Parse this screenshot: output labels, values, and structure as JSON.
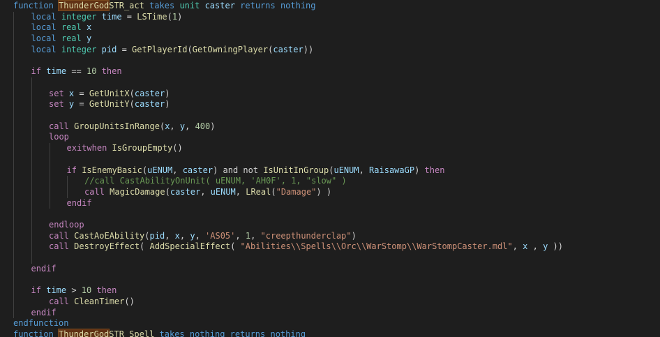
{
  "editor": {
    "theme": {
      "background": "#1e1e1e",
      "keyword": "#569cd6",
      "control": "#c586c0",
      "function": "#dcdcaa",
      "variable": "#9cdcfe",
      "type": "#4ec9b0",
      "string": "#ce9178",
      "number": "#b5cea8",
      "comment": "#6a9955",
      "highlight": "#613214"
    },
    "lines": [
      {
        "indent": 0,
        "tokens": [
          {
            "t": "function",
            "c": "kw"
          },
          {
            "t": " ",
            "c": "plain"
          },
          {
            "t": "ThunderGod",
            "c": "hl"
          },
          {
            "t": "STR_act",
            "c": "fn"
          },
          {
            "t": " takes ",
            "c": "kw"
          },
          {
            "t": "unit",
            "c": "type"
          },
          {
            "t": " caster ",
            "c": "var"
          },
          {
            "t": "returns nothing",
            "c": "kw"
          }
        ]
      },
      {
        "indent": 1,
        "tokens": [
          {
            "t": "local ",
            "c": "kw"
          },
          {
            "t": "integer",
            "c": "type"
          },
          {
            "t": " time",
            "c": "var"
          },
          {
            "t": " = ",
            "c": "op"
          },
          {
            "t": "LSTime",
            "c": "fn"
          },
          {
            "t": "(",
            "c": "op"
          },
          {
            "t": "1",
            "c": "num"
          },
          {
            "t": ")",
            "c": "op"
          }
        ]
      },
      {
        "indent": 1,
        "tokens": [
          {
            "t": "local ",
            "c": "kw"
          },
          {
            "t": "real",
            "c": "type"
          },
          {
            "t": " x",
            "c": "var"
          }
        ]
      },
      {
        "indent": 1,
        "tokens": [
          {
            "t": "local ",
            "c": "kw"
          },
          {
            "t": "real",
            "c": "type"
          },
          {
            "t": " y",
            "c": "var"
          }
        ]
      },
      {
        "indent": 1,
        "tokens": [
          {
            "t": "local ",
            "c": "kw"
          },
          {
            "t": "integer",
            "c": "type"
          },
          {
            "t": " pid",
            "c": "var"
          },
          {
            "t": " = ",
            "c": "op"
          },
          {
            "t": "GetPlayerId",
            "c": "fn"
          },
          {
            "t": "(",
            "c": "op"
          },
          {
            "t": "GetOwningPlayer",
            "c": "fn"
          },
          {
            "t": "(",
            "c": "op"
          },
          {
            "t": "caster",
            "c": "var"
          },
          {
            "t": "))",
            "c": "op"
          }
        ]
      },
      {
        "indent": 0,
        "tokens": []
      },
      {
        "indent": 1,
        "tokens": [
          {
            "t": "if ",
            "c": "ctrl"
          },
          {
            "t": "time",
            "c": "var"
          },
          {
            "t": " == ",
            "c": "op"
          },
          {
            "t": "10",
            "c": "num"
          },
          {
            "t": " then",
            "c": "ctrl"
          }
        ]
      },
      {
        "indent": 0,
        "tokens": []
      },
      {
        "indent": 2,
        "tokens": [
          {
            "t": "set ",
            "c": "ctrl"
          },
          {
            "t": "x",
            "c": "var"
          },
          {
            "t": " = ",
            "c": "op"
          },
          {
            "t": "GetUnitX",
            "c": "fn"
          },
          {
            "t": "(",
            "c": "op"
          },
          {
            "t": "caster",
            "c": "var"
          },
          {
            "t": ")",
            "c": "op"
          }
        ]
      },
      {
        "indent": 2,
        "tokens": [
          {
            "t": "set ",
            "c": "ctrl"
          },
          {
            "t": "y",
            "c": "var"
          },
          {
            "t": " = ",
            "c": "op"
          },
          {
            "t": "GetUnitY",
            "c": "fn"
          },
          {
            "t": "(",
            "c": "op"
          },
          {
            "t": "caster",
            "c": "var"
          },
          {
            "t": ")",
            "c": "op"
          }
        ]
      },
      {
        "indent": 0,
        "tokens": []
      },
      {
        "indent": 2,
        "tokens": [
          {
            "t": "call ",
            "c": "ctrl"
          },
          {
            "t": "GroupUnitsInRange",
            "c": "fn"
          },
          {
            "t": "(",
            "c": "op"
          },
          {
            "t": "x",
            "c": "var"
          },
          {
            "t": ", ",
            "c": "op"
          },
          {
            "t": "y",
            "c": "var"
          },
          {
            "t": ", ",
            "c": "op"
          },
          {
            "t": "400",
            "c": "num"
          },
          {
            "t": ")",
            "c": "op"
          }
        ]
      },
      {
        "indent": 2,
        "tokens": [
          {
            "t": "loop",
            "c": "ctrl"
          }
        ]
      },
      {
        "indent": 3,
        "tokens": [
          {
            "t": "exitwhen ",
            "c": "ctrl"
          },
          {
            "t": "IsGroupEmpty",
            "c": "fn"
          },
          {
            "t": "()",
            "c": "op"
          }
        ]
      },
      {
        "indent": 0,
        "tokens": []
      },
      {
        "indent": 3,
        "tokens": [
          {
            "t": "if ",
            "c": "ctrl"
          },
          {
            "t": "IsEnemyBasic",
            "c": "fn"
          },
          {
            "t": "(",
            "c": "op"
          },
          {
            "t": "uENUM",
            "c": "var"
          },
          {
            "t": ", ",
            "c": "op"
          },
          {
            "t": "caster",
            "c": "var"
          },
          {
            "t": ") ",
            "c": "op"
          },
          {
            "t": "and not ",
            "c": "plain"
          },
          {
            "t": "IsUnitInGroup",
            "c": "fn"
          },
          {
            "t": "(",
            "c": "op"
          },
          {
            "t": "uENUM",
            "c": "var"
          },
          {
            "t": ", ",
            "c": "op"
          },
          {
            "t": "RaisawaGP",
            "c": "var"
          },
          {
            "t": ") ",
            "c": "op"
          },
          {
            "t": "then",
            "c": "ctrl"
          }
        ]
      },
      {
        "indent": 4,
        "tokens": [
          {
            "t": "//call CastAbilityOnUnit( uENUM, 'AH0F', 1, \"slow\" )",
            "c": "cmt"
          }
        ]
      },
      {
        "indent": 4,
        "tokens": [
          {
            "t": "call ",
            "c": "ctrl"
          },
          {
            "t": "MagicDamage",
            "c": "fn"
          },
          {
            "t": "(",
            "c": "op"
          },
          {
            "t": "caster",
            "c": "var"
          },
          {
            "t": ", ",
            "c": "op"
          },
          {
            "t": "uENUM",
            "c": "var"
          },
          {
            "t": ", ",
            "c": "op"
          },
          {
            "t": "LReal",
            "c": "fn"
          },
          {
            "t": "(",
            "c": "op"
          },
          {
            "t": "\"Damage\"",
            "c": "str"
          },
          {
            "t": ") )",
            "c": "op"
          }
        ]
      },
      {
        "indent": 3,
        "tokens": [
          {
            "t": "endif",
            "c": "ctrl"
          }
        ]
      },
      {
        "indent": 0,
        "tokens": []
      },
      {
        "indent": 2,
        "tokens": [
          {
            "t": "endloop",
            "c": "ctrl"
          }
        ]
      },
      {
        "indent": 2,
        "tokens": [
          {
            "t": "call ",
            "c": "ctrl"
          },
          {
            "t": "CastAoEAbility",
            "c": "fn"
          },
          {
            "t": "(",
            "c": "op"
          },
          {
            "t": "pid",
            "c": "var"
          },
          {
            "t": ", ",
            "c": "op"
          },
          {
            "t": "x",
            "c": "var"
          },
          {
            "t": ", ",
            "c": "op"
          },
          {
            "t": "y",
            "c": "var"
          },
          {
            "t": ", ",
            "c": "op"
          },
          {
            "t": "'AS05'",
            "c": "str"
          },
          {
            "t": ", ",
            "c": "op"
          },
          {
            "t": "1",
            "c": "num"
          },
          {
            "t": ", ",
            "c": "op"
          },
          {
            "t": "\"creepthunderclap\"",
            "c": "str"
          },
          {
            "t": ")",
            "c": "op"
          }
        ]
      },
      {
        "indent": 2,
        "tokens": [
          {
            "t": "call ",
            "c": "ctrl"
          },
          {
            "t": "DestroyEffect",
            "c": "fn"
          },
          {
            "t": "( ",
            "c": "op"
          },
          {
            "t": "AddSpecialEffect",
            "c": "fn"
          },
          {
            "t": "( ",
            "c": "op"
          },
          {
            "t": "\"Abilities\\\\Spells\\\\Orc\\\\WarStomp\\\\WarStompCaster.mdl\"",
            "c": "str"
          },
          {
            "t": ", ",
            "c": "op"
          },
          {
            "t": "x",
            "c": "var"
          },
          {
            "t": " , ",
            "c": "op"
          },
          {
            "t": "y",
            "c": "var"
          },
          {
            "t": " ))",
            "c": "op"
          }
        ]
      },
      {
        "indent": 0,
        "tokens": []
      },
      {
        "indent": 1,
        "tokens": [
          {
            "t": "endif",
            "c": "ctrl"
          }
        ]
      },
      {
        "indent": 0,
        "tokens": []
      },
      {
        "indent": 1,
        "tokens": [
          {
            "t": "if ",
            "c": "ctrl"
          },
          {
            "t": "time",
            "c": "var"
          },
          {
            "t": " > ",
            "c": "op"
          },
          {
            "t": "10",
            "c": "num"
          },
          {
            "t": " then",
            "c": "ctrl"
          }
        ]
      },
      {
        "indent": 2,
        "tokens": [
          {
            "t": "call ",
            "c": "ctrl"
          },
          {
            "t": "CleanTimer",
            "c": "fn"
          },
          {
            "t": "()",
            "c": "op"
          }
        ]
      },
      {
        "indent": 1,
        "tokens": [
          {
            "t": "endif",
            "c": "ctrl"
          }
        ]
      },
      {
        "indent": 0,
        "tokens": [
          {
            "t": "endfunction",
            "c": "kw"
          }
        ]
      },
      {
        "indent": 0,
        "tokens": [
          {
            "t": "function",
            "c": "kw"
          },
          {
            "t": " ",
            "c": "plain"
          },
          {
            "t": "ThunderGod",
            "c": "hl"
          },
          {
            "t": "STR_Spell",
            "c": "fn"
          },
          {
            "t": " takes nothing returns nothing",
            "c": "kw"
          }
        ]
      }
    ]
  }
}
